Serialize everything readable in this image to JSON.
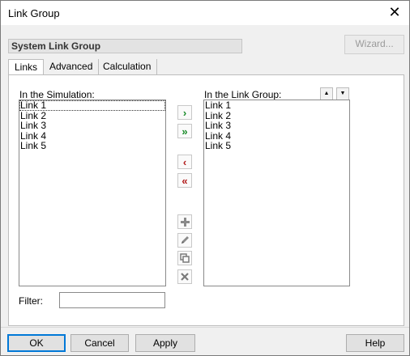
{
  "window": {
    "title": "Link Group",
    "close_glyph": "✕"
  },
  "group_name": "System Link Group",
  "wizard_label": "Wizard...",
  "tabs": [
    {
      "label": "Links",
      "active": true
    },
    {
      "label": "Advanced",
      "active": false
    },
    {
      "label": "Calculation",
      "active": false
    }
  ],
  "left_list": {
    "label": "In the Simulation:",
    "items": [
      "Link 1",
      "Link 2",
      "Link 3",
      "Link 4",
      "Link 5"
    ]
  },
  "right_list": {
    "label": "In the Link Group:",
    "items": [
      "Link 1",
      "Link 2",
      "Link 3",
      "Link 4",
      "Link 5"
    ]
  },
  "transfer_buttons": {
    "add_one": "›",
    "add_all": "»",
    "remove_one": "‹",
    "remove_all": "«"
  },
  "action_icons": {
    "add": "plus-icon",
    "edit": "pencil-icon",
    "copy": "copy-icon",
    "delete": "delete-icon"
  },
  "sort_buttons": {
    "up": "▲",
    "down": "▼"
  },
  "filter": {
    "label": "Filter:",
    "value": ""
  },
  "footer": {
    "ok": "OK",
    "cancel": "Cancel",
    "apply": "Apply",
    "help": "Help"
  },
  "colors": {
    "accent": "#0078d7",
    "green_arrow": "#1a8c2a",
    "red_arrow": "#b21c1c"
  }
}
